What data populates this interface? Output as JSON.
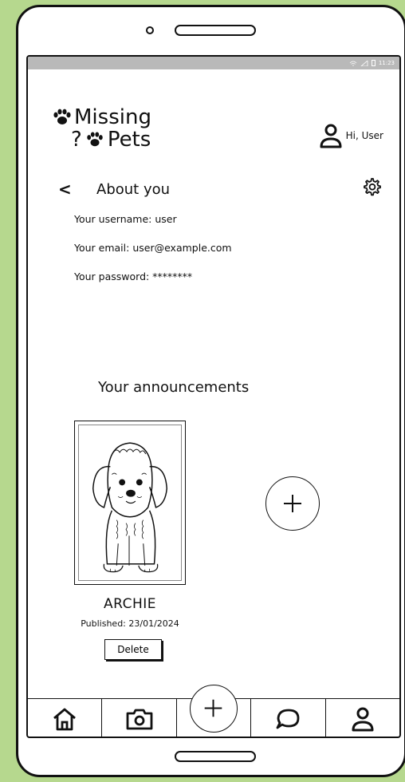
{
  "status_bar": {
    "time": "11:23"
  },
  "header": {
    "logo_line1": "Missing",
    "logo_line2_prefix": "?",
    "logo_line2": "Pets",
    "greeting": "Hi, User",
    "icons": [
      "paw-icon",
      "user-icon"
    ]
  },
  "about": {
    "back_label": "<",
    "title": "About you",
    "username": "Your username: user",
    "email": "Your email: user@example.com",
    "password": "Your password: ********"
  },
  "announcements": {
    "title": "Your announcements",
    "items": [
      {
        "name": "ARCHIE",
        "published": "Published: 23/01/2024",
        "delete_label": "Delete",
        "image": "dog-sketch"
      }
    ],
    "add_icon": "plus-icon"
  },
  "bottom_nav": {
    "items": [
      "home-icon",
      "camera-icon",
      "plus-icon",
      "chat-icon",
      "user-icon"
    ]
  }
}
